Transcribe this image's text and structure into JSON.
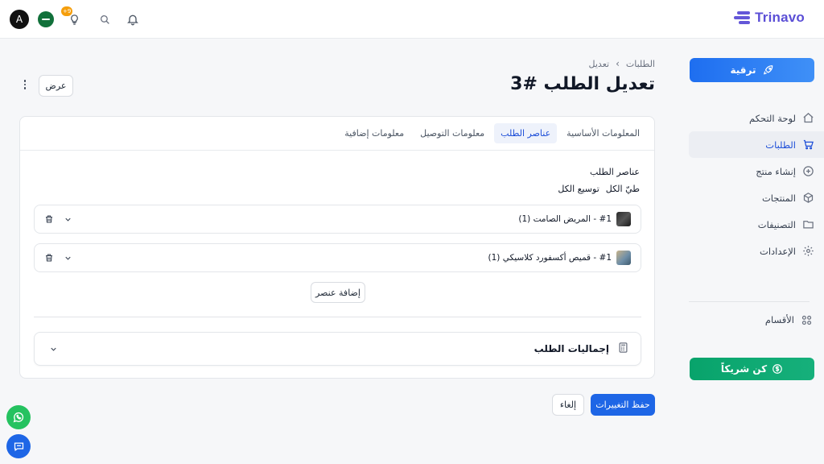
{
  "header": {
    "brand": "Trinavo",
    "avatar_letter": "A",
    "notification_count": "+9",
    "icons": [
      "bell-icon",
      "search-icon",
      "lightbulb-icon",
      "flag-icon"
    ]
  },
  "sidebar": {
    "upgrade_label": "ترقية",
    "items": [
      {
        "label": "لوحة التحكم",
        "icon": "home-icon"
      },
      {
        "label": "الطلبات",
        "icon": "cart-icon"
      },
      {
        "label": "إنشاء منتج",
        "icon": "plus-circle-icon"
      },
      {
        "label": "المنتجات",
        "icon": "box-icon"
      },
      {
        "label": "التصنيفات",
        "icon": "folder-icon"
      },
      {
        "label": "الإعدادات",
        "icon": "gear-icon"
      }
    ],
    "sections_label": "الأقسام",
    "partner_label": "كن شريكاً"
  },
  "page": {
    "breadcrumb": [
      "الطلبات",
      "تعديل"
    ],
    "title": "تعديل الطلب #3",
    "view_label": "عرض"
  },
  "tabs": [
    {
      "label": "المعلومات الأساسية"
    },
    {
      "label": "عناصر الطلب"
    },
    {
      "label": "معلومات التوصيل"
    },
    {
      "label": "معلومات إضافية"
    }
  ],
  "items_section": {
    "title": "عناصر الطلب",
    "collapse_all": "طيّ الكل",
    "expand_all": "توسيع الكل",
    "items": [
      {
        "label": "#1 - المريض الصامت (1)"
      },
      {
        "label": "#1 - قميص أكسفورد كلاسيكي (1)"
      }
    ],
    "add_item_label": "إضافة عنصر"
  },
  "totals": {
    "label": "إجماليات الطلب"
  },
  "actions": {
    "save_label": "حفظ التغييرات",
    "cancel_label": "إلغاء"
  },
  "colors": {
    "primary": "#1e66e6",
    "brand": "#5b4fd6",
    "partner": "#08a36b",
    "badge": "#f59e0b"
  }
}
